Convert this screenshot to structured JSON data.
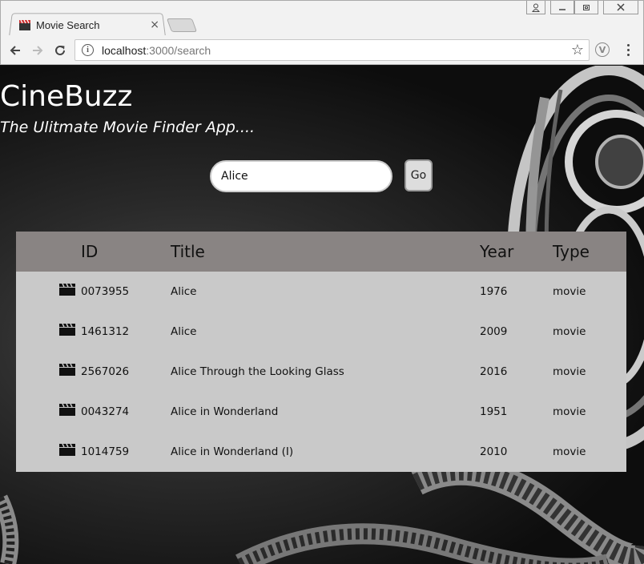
{
  "browser": {
    "tab_title": "Movie Search",
    "tab_close": "×",
    "url_host": "localhost",
    "url_path": ":3000/search",
    "star": "☆",
    "extension_letter": "V"
  },
  "app": {
    "title": "CineBuzz",
    "subtitle": "The Ulitmate Movie Finder App....",
    "search": {
      "value": "Alice",
      "button_label": "Go"
    },
    "results": {
      "columns": [
        "ID",
        "Title",
        "Year",
        "Type"
      ],
      "rows": [
        {
          "id": "0073955",
          "title": "Alice",
          "year": "1976",
          "type": "movie"
        },
        {
          "id": "1461312",
          "title": "Alice",
          "year": "2009",
          "type": "movie"
        },
        {
          "id": "2567026",
          "title": "Alice Through the Looking Glass",
          "year": "2016",
          "type": "movie"
        },
        {
          "id": "0043274",
          "title": "Alice in Wonderland",
          "year": "1951",
          "type": "movie"
        },
        {
          "id": "1014759",
          "title": "Alice in Wonderland (I)",
          "year": "2010",
          "type": "movie"
        }
      ]
    }
  },
  "colors": {
    "table_header": "#898483",
    "table_body": "#c9c9c9",
    "text_light": "#ffffff"
  }
}
